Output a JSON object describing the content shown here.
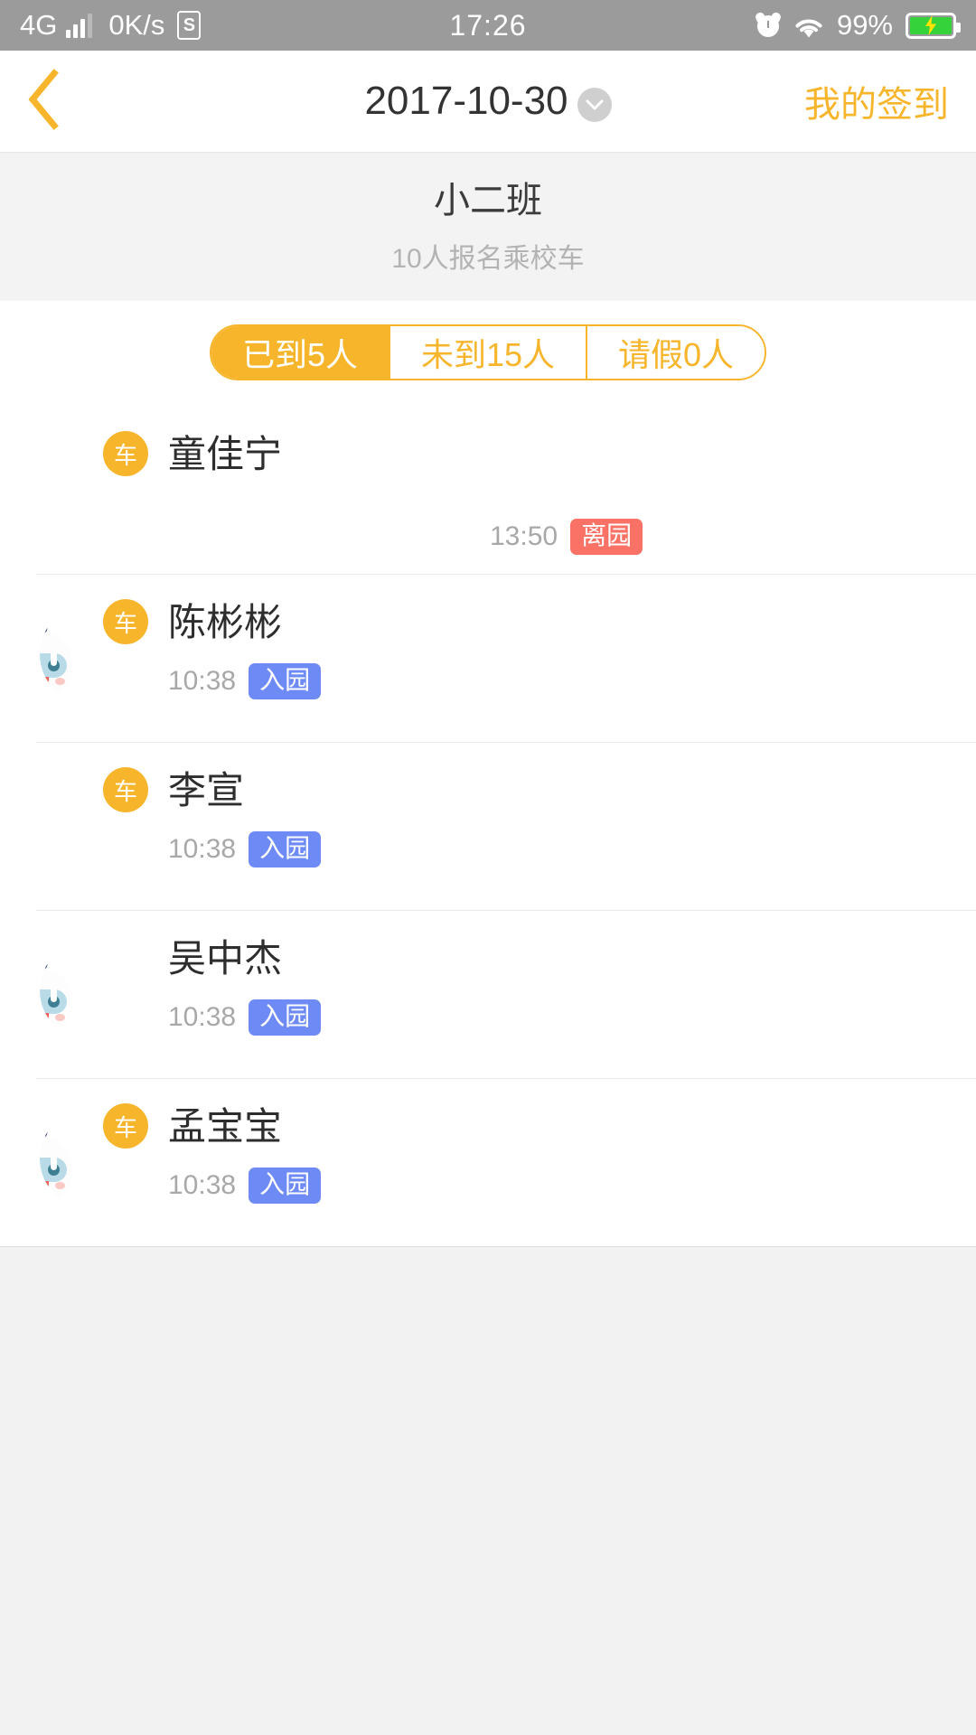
{
  "status_bar": {
    "network": "4G",
    "speed": "0K/s",
    "sim_icon_label": "S",
    "time": "17:26",
    "battery_percent": "99%",
    "alarm_icon": "alarm-clock-icon",
    "wifi_icon": "wifi-icon",
    "battery_icon": "battery-charging-icon",
    "battery_color": "#35d23b"
  },
  "navbar": {
    "back_icon": "chevron-left-icon",
    "title": "2017-10-30",
    "dropdown_icon": "chevron-down-icon",
    "right_action": "我的签到",
    "accent_color": "#f7b52c"
  },
  "class_header": {
    "name": "小二班",
    "subtitle": "10人报名乘校车"
  },
  "tabs": [
    {
      "label": "已到5人",
      "active": true
    },
    {
      "label": "未到15人",
      "active": false
    },
    {
      "label": "请假0人",
      "active": false
    }
  ],
  "students": [
    {
      "name": "童佳宁",
      "time": "13:50",
      "tag": "离园",
      "tag_type": "leave",
      "tag_color": "#fa7265",
      "avatar_type": "photo-a",
      "bus_badge": "车",
      "meta_right": true
    },
    {
      "name": "陈彬彬",
      "time": "10:38",
      "tag": "入园",
      "tag_type": "enter",
      "tag_color": "#6e8bf5",
      "avatar_type": "robot",
      "bus_badge": "车",
      "meta_right": false
    },
    {
      "name": "李宣",
      "time": "10:38",
      "tag": "入园",
      "tag_type": "enter",
      "tag_color": "#6e8bf5",
      "avatar_type": "photo-b",
      "bus_badge": "车",
      "meta_right": false
    },
    {
      "name": "吴中杰",
      "time": "10:38",
      "tag": "入园",
      "tag_type": "enter",
      "tag_color": "#6e8bf5",
      "avatar_type": "robot",
      "bus_badge": "",
      "meta_right": false
    },
    {
      "name": "孟宝宝",
      "time": "10:38",
      "tag": "入园",
      "tag_type": "enter",
      "tag_color": "#6e8bf5",
      "avatar_type": "robot",
      "bus_badge": "车",
      "meta_right": false
    }
  ]
}
